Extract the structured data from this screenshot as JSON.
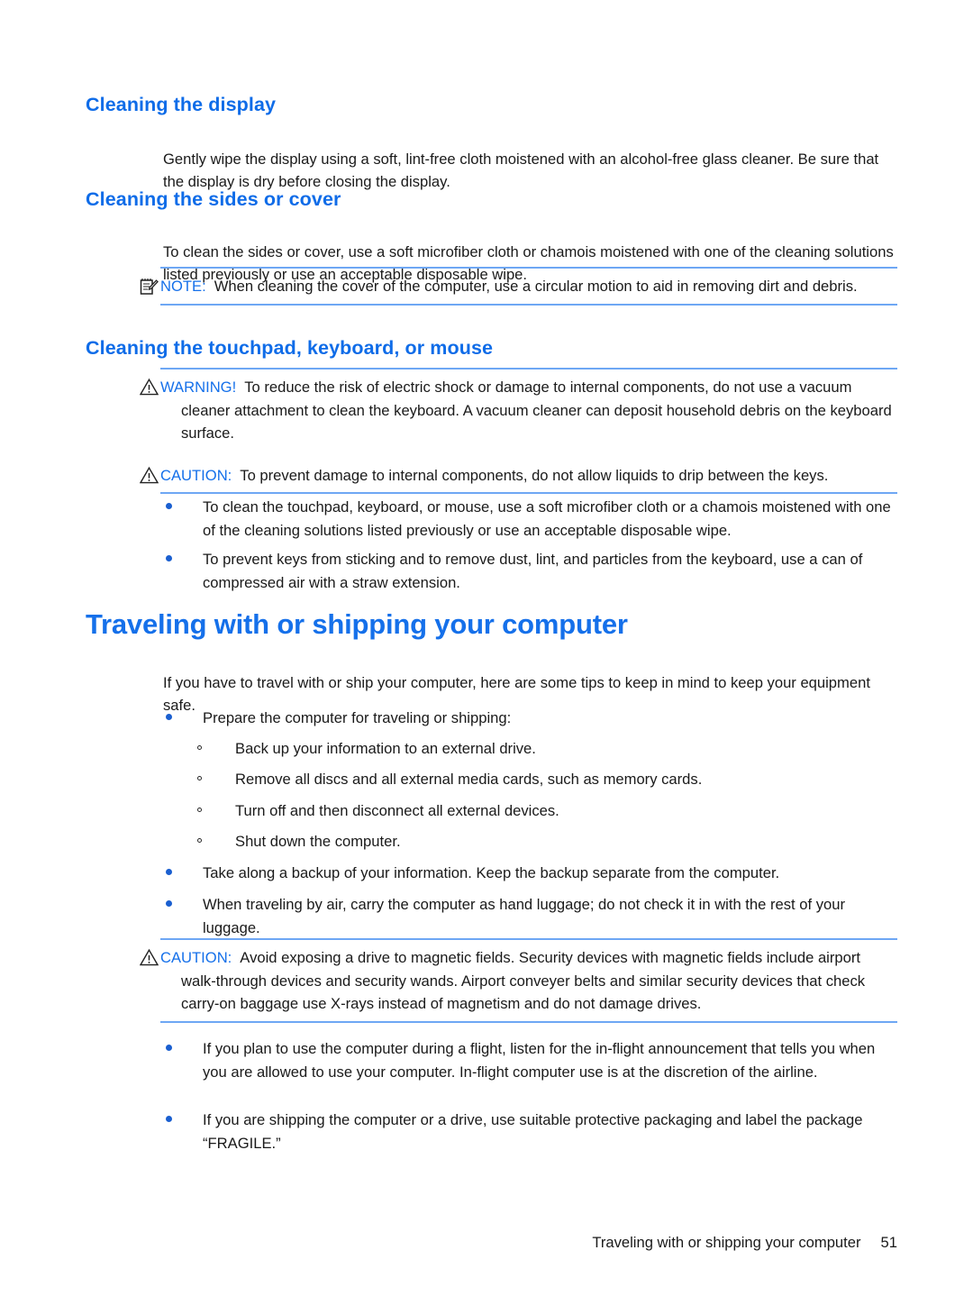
{
  "document": {
    "sections": [
      {
        "id": "cleaning-display",
        "heading": "Cleaning the display",
        "body": "Gently wipe the display using a soft, lint-free cloth moistened with an alcohol-free glass cleaner. Be sure that the display is dry before closing the display."
      },
      {
        "id": "cleaning-sides-cover",
        "heading": "Cleaning the sides or cover",
        "body": "To clean the sides or cover, use a soft microfiber cloth or chamois moistened with one of the cleaning solutions listed previously or use an acceptable disposable wipe."
      },
      {
        "id": "cleaning-touchpad",
        "heading": "Cleaning the touchpad, keyboard, or mouse"
      }
    ],
    "main_heading": "Traveling with or shipping your computer",
    "main_intro": "If you have to travel with or ship your computer, here are some tips to keep in mind to keep your equipment safe."
  },
  "admonitions": {
    "note_cover": {
      "icon": "note-pad-pencil-icon",
      "label": "NOTE:",
      "text": "When cleaning the cover of the computer, use a circular motion to aid in removing dirt and debris."
    },
    "warning_vacuum": {
      "icon": "warning-triangle-icon",
      "label": "WARNING!",
      "text": "To reduce the risk of electric shock or damage to internal components, do not use a vacuum cleaner attachment to clean the keyboard. A vacuum cleaner can deposit household debris on the keyboard surface."
    },
    "caution_liquids": {
      "icon": "warning-triangle-icon",
      "label": "CAUTION:",
      "text": "To prevent damage to internal components, do not allow liquids to drip between the keys."
    },
    "caution_magnetic": {
      "icon": "warning-triangle-icon",
      "label": "CAUTION:",
      "text": "Avoid exposing a drive to magnetic fields. Security devices with magnetic fields include airport walk-through devices and security wands. Airport conveyer belts and similar security devices that check carry-on baggage use X-rays instead of magnetism and do not damage drives."
    }
  },
  "cleaning_bullets": [
    "To clean the touchpad, keyboard, or mouse, use a soft microfiber cloth or a chamois moistened with one of the cleaning solutions listed previously or use an acceptable disposable wipe.",
    "To prevent keys from sticking and to remove dust, lint, and particles from the keyboard, use a can of compressed air with a straw extension."
  ],
  "travel_bullets_top": [
    "Prepare the computer for traveling or shipping:"
  ],
  "travel_subbullets": [
    "Back up your information to an external drive.",
    "Remove all discs and all external media cards, such as memory cards.",
    "Turn off and then disconnect all external devices.",
    "Shut down the computer."
  ],
  "travel_bullets_mid": [
    "Take along a backup of your information. Keep the backup separate from the computer.",
    "When traveling by air, carry the computer as hand luggage; do not check it in with the rest of your luggage."
  ],
  "travel_bullets_bottom": [
    "If you plan to use the computer during a flight, listen for the in-flight announcement that tells you when you are allowed to use your computer. In-flight computer use is at the discretion of the airline.",
    "If you are shipping the computer or a drive, use suitable protective packaging and label the package “FRAGILE.”"
  ],
  "footer": {
    "text": "Traveling with or shipping your computer",
    "page_number": "51"
  },
  "colors": {
    "heading_blue": "#0f6ce8",
    "rule_blue": "#6ea7f4",
    "bullet_blue": "#1a5fd0",
    "body_black": "#1a1a1a"
  }
}
